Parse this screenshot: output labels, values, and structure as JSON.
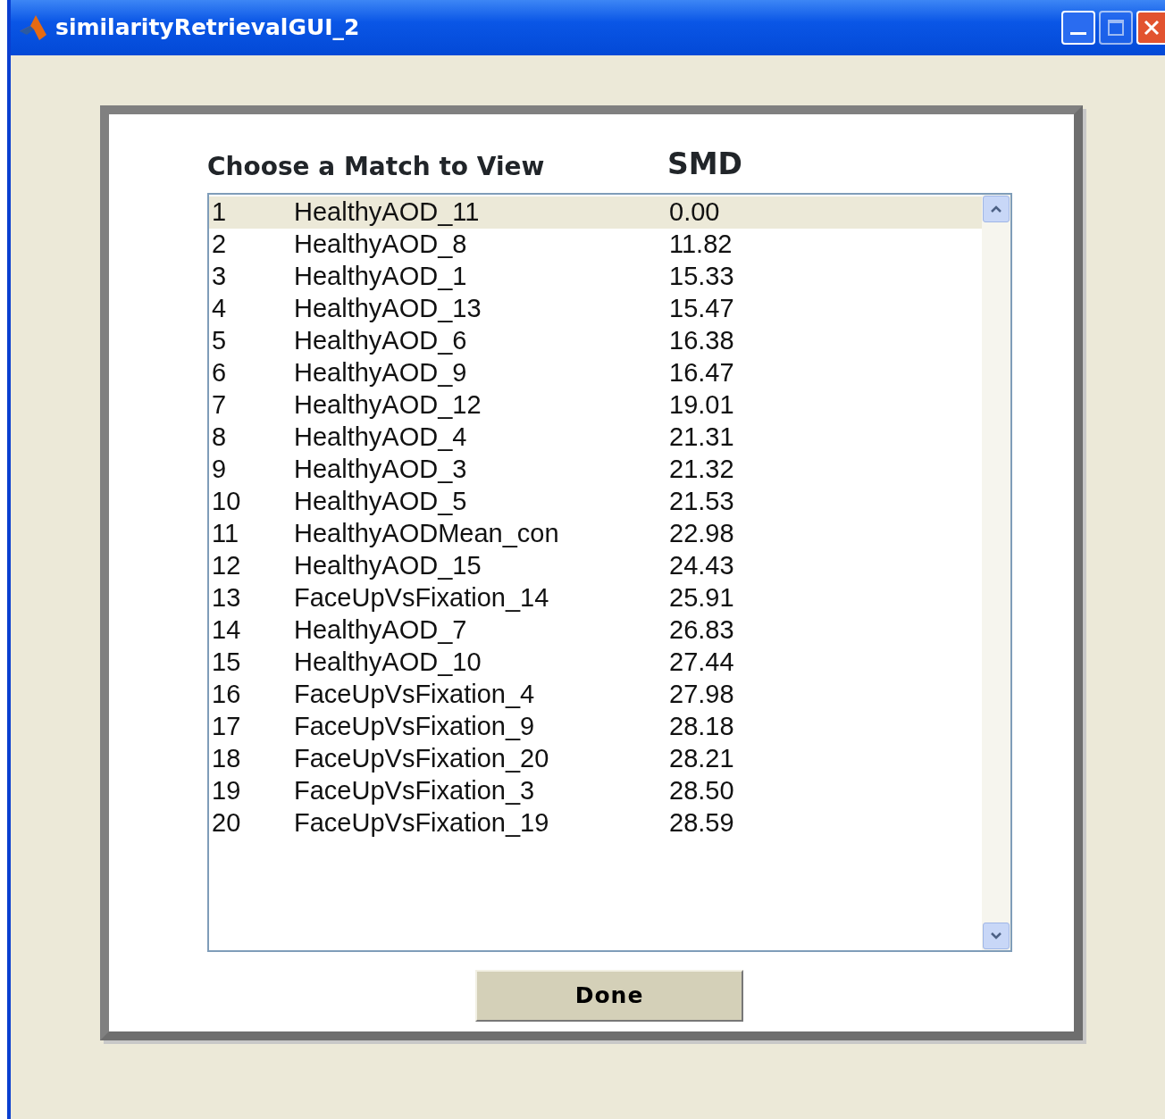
{
  "window": {
    "title": "similarityRetrievalGUI_2"
  },
  "panel": {
    "heading": "Choose a Match to View",
    "column_heading": "SMD"
  },
  "matches": [
    {
      "index": "1",
      "name": "HealthyAOD_11",
      "smd": "0.00",
      "selected": true
    },
    {
      "index": "2",
      "name": "HealthyAOD_8",
      "smd": "11.82",
      "selected": false
    },
    {
      "index": "3",
      "name": "HealthyAOD_1",
      "smd": "15.33",
      "selected": false
    },
    {
      "index": "4",
      "name": "HealthyAOD_13",
      "smd": "15.47",
      "selected": false
    },
    {
      "index": "5",
      "name": "HealthyAOD_6",
      "smd": "16.38",
      "selected": false
    },
    {
      "index": "6",
      "name": "HealthyAOD_9",
      "smd": "16.47",
      "selected": false
    },
    {
      "index": "7",
      "name": "HealthyAOD_12",
      "smd": "19.01",
      "selected": false
    },
    {
      "index": "8",
      "name": "HealthyAOD_4",
      "smd": "21.31",
      "selected": false
    },
    {
      "index": "9",
      "name": "HealthyAOD_3",
      "smd": "21.32",
      "selected": false
    },
    {
      "index": "10",
      "name": "HealthyAOD_5",
      "smd": "21.53",
      "selected": false
    },
    {
      "index": "11",
      "name": "HealthyAODMean_con",
      "smd": "22.98",
      "selected": false
    },
    {
      "index": "12",
      "name": "HealthyAOD_15",
      "smd": "24.43",
      "selected": false
    },
    {
      "index": "13",
      "name": "FaceUpVsFixation_14",
      "smd": "25.91",
      "selected": false
    },
    {
      "index": "14",
      "name": "HealthyAOD_7",
      "smd": "26.83",
      "selected": false
    },
    {
      "index": "15",
      "name": "HealthyAOD_10",
      "smd": "27.44",
      "selected": false
    },
    {
      "index": "16",
      "name": "FaceUpVsFixation_4",
      "smd": "27.98",
      "selected": false
    },
    {
      "index": "17",
      "name": "FaceUpVsFixation_9",
      "smd": "28.18",
      "selected": false
    },
    {
      "index": "18",
      "name": "FaceUpVsFixation_20",
      "smd": "28.21",
      "selected": false
    },
    {
      "index": "19",
      "name": "FaceUpVsFixation_3",
      "smd": "28.50",
      "selected": false
    },
    {
      "index": "20",
      "name": "FaceUpVsFixation_19",
      "smd": "28.59",
      "selected": false
    }
  ],
  "buttons": [
    {
      "label": "Done"
    }
  ]
}
